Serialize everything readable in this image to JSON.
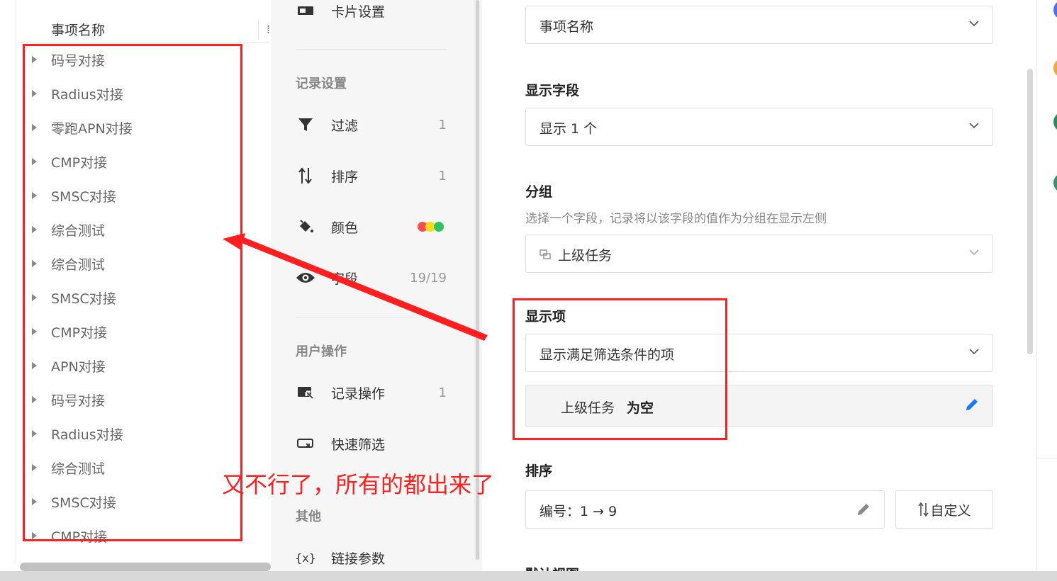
{
  "tree": {
    "header": "事项名称",
    "items": [
      "码号对接",
      "Radius对接",
      "零跑APN对接",
      "CMP对接",
      "SMSC对接",
      "综合测试",
      "综合测试",
      "SMSC对接",
      "CMP对接",
      "APN对接",
      "码号对接",
      "Radius对接",
      "综合测试",
      "SMSC对接",
      "CMP对接"
    ]
  },
  "sidebar": {
    "card_settings": "卡片设置",
    "record_settings_title": "记录设置",
    "filter": {
      "label": "过滤",
      "count": "1"
    },
    "sort": {
      "label": "排序",
      "count": "1"
    },
    "color": {
      "label": "颜色"
    },
    "fields": {
      "label": "字段",
      "count": "19/19"
    },
    "user_actions_title": "用户操作",
    "record_actions": {
      "label": "记录操作",
      "count": "1"
    },
    "quick_filter": {
      "label": "快速筛选"
    },
    "other_title": "其他",
    "link_params": {
      "label": "链接参数"
    }
  },
  "config": {
    "title_field_value": "事项名称",
    "display_fields_label": "显示字段",
    "display_fields_value": "显示 1 个",
    "group_label": "分组",
    "group_desc": "选择一个字段，记录将以该字段的值作为分组在显示左侧",
    "group_value": "上级任务",
    "display_items_label": "显示项",
    "display_items_value": "显示满足筛选条件的项",
    "filter_condition_field": "上级任务",
    "filter_condition_op": "为空",
    "sort_label": "排序",
    "sort_value": "编号：1 → 9",
    "custom_button": "自定义",
    "default_view_label": "默认视图"
  },
  "annotation": {
    "text": "又不行了，所有的都出来了",
    "color": "#ff1f1f"
  },
  "colors": {
    "dot_red": "#ff4d4f",
    "dot_yellow": "#fadb14",
    "dot_green": "#2ec55e",
    "accent_blue": "#1677ff"
  }
}
